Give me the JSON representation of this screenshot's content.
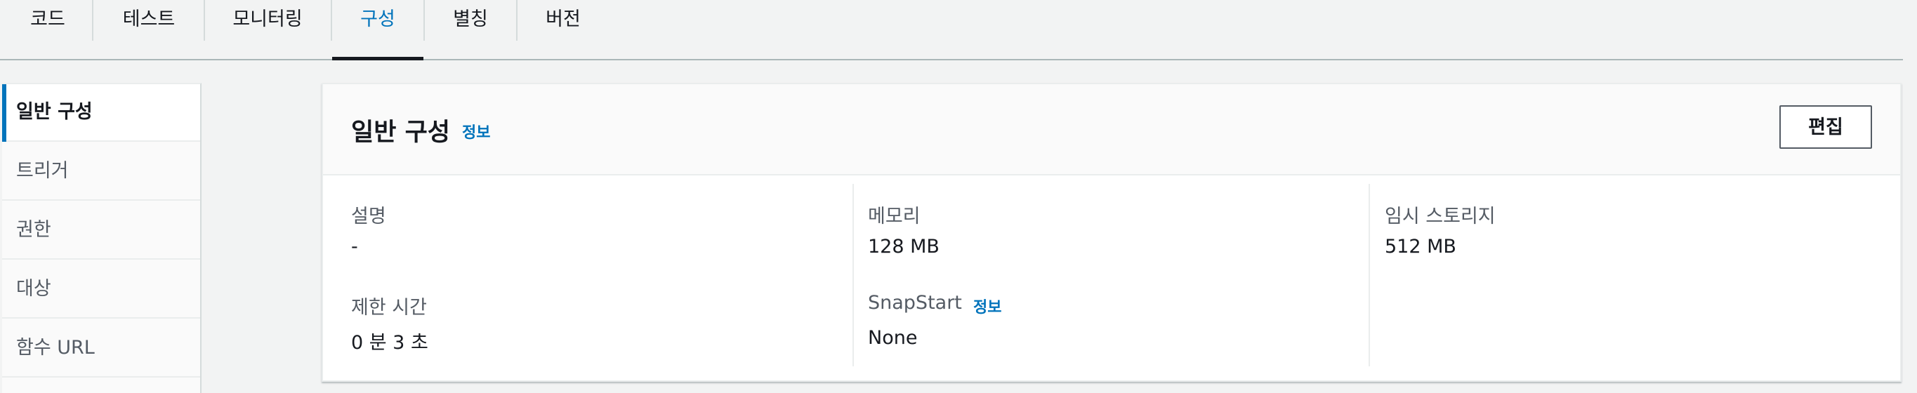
{
  "tabs": [
    {
      "label": "코드",
      "active": false
    },
    {
      "label": "테스트",
      "active": false
    },
    {
      "label": "모니터링",
      "active": false
    },
    {
      "label": "구성",
      "active": true
    },
    {
      "label": "별칭",
      "active": false
    },
    {
      "label": "버전",
      "active": false
    }
  ],
  "sidenav": {
    "items": [
      {
        "label": "일반 구성",
        "active": true
      },
      {
        "label": "트리거",
        "active": false
      },
      {
        "label": "권한",
        "active": false
      },
      {
        "label": "대상",
        "active": false
      },
      {
        "label": "함수 URL",
        "active": false
      }
    ]
  },
  "panel": {
    "title": "일반 구성",
    "info_label": "정보",
    "edit_label": "편집",
    "fields": {
      "description": {
        "label": "설명",
        "value": "-"
      },
      "memory": {
        "label": "메모리",
        "value": "128  MB"
      },
      "ephemeral_storage": {
        "label": "임시 스토리지",
        "value": "512  MB"
      },
      "timeout": {
        "label": "제한 시간",
        "value": "0  분   3  초"
      },
      "snapstart": {
        "label": "SnapStart",
        "info_label": "정보",
        "value": "None"
      }
    }
  },
  "colors": {
    "accent": "#0073bb",
    "text": "#16191f",
    "muted_text": "#545b64",
    "background": "#f2f3f3",
    "border": "#eaeded"
  }
}
